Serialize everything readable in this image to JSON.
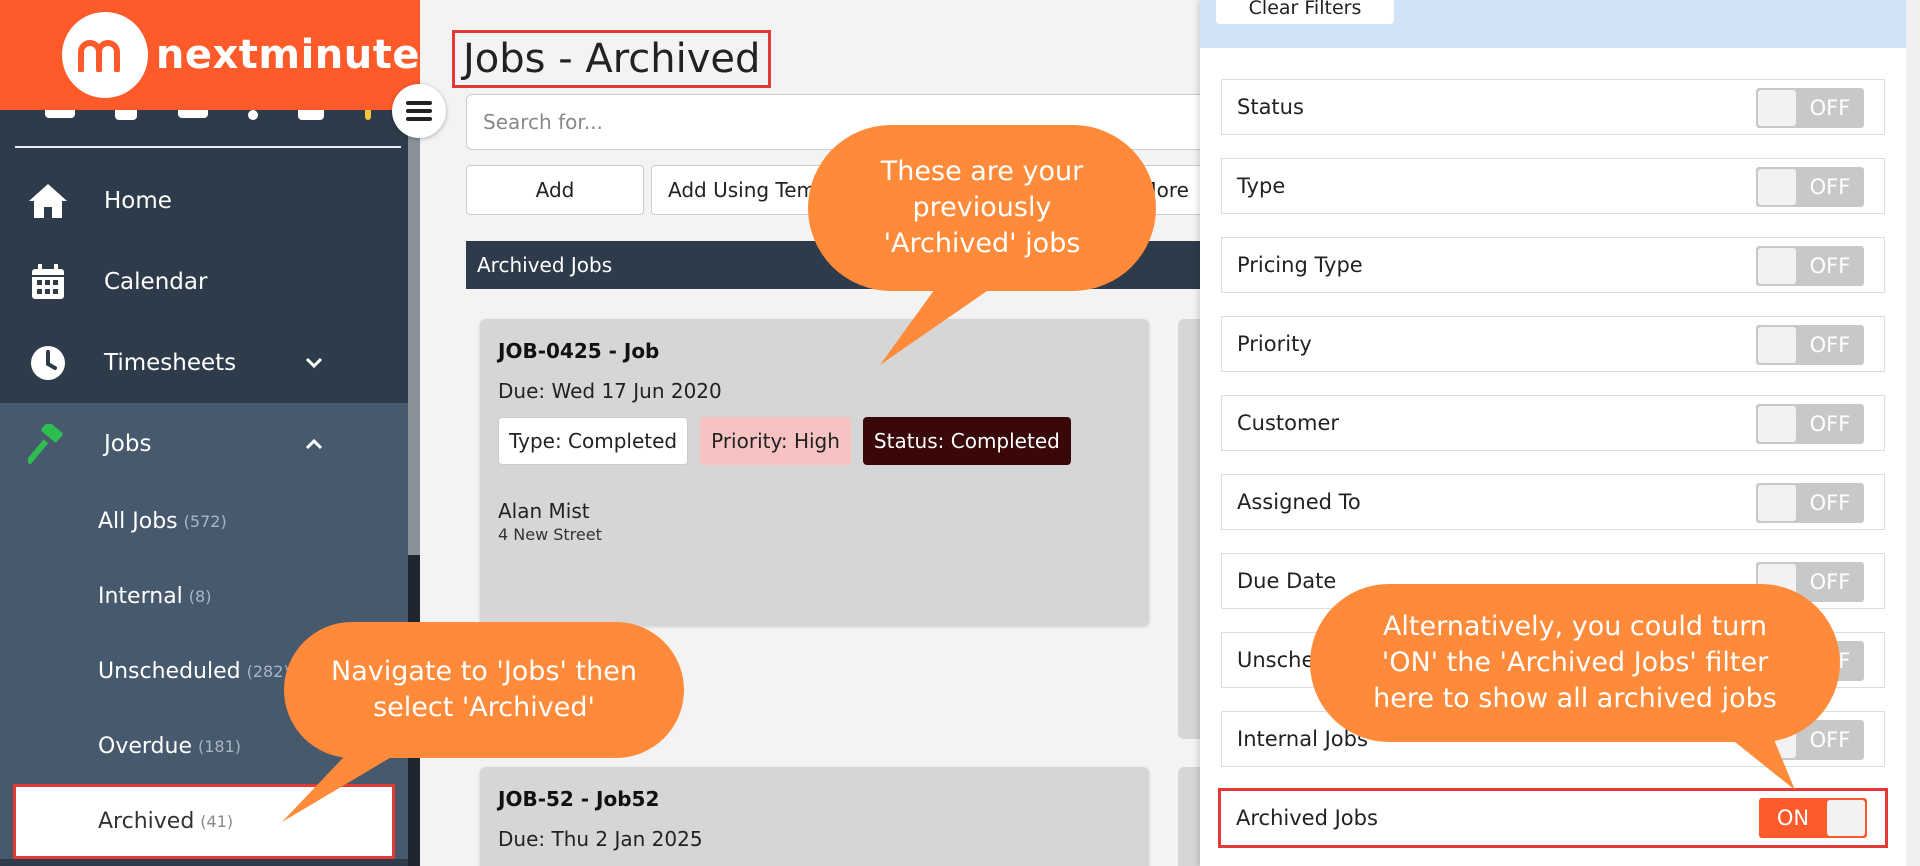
{
  "app": {
    "brand": "nextminute",
    "brand_color": "#ff5a2a",
    "accent_dark": "#2e3b4a"
  },
  "sidebar": {
    "items": [
      {
        "label": "Home",
        "icon": "home-icon"
      },
      {
        "label": "Calendar",
        "icon": "calendar-icon"
      },
      {
        "label": "Timesheets",
        "icon": "clock-icon"
      },
      {
        "label": "Jobs",
        "icon": "hammer-icon"
      }
    ],
    "jobs_sub": [
      {
        "label": "All Jobs",
        "count": "(572)"
      },
      {
        "label": "Internal",
        "count": "(8)"
      },
      {
        "label": "Unscheduled",
        "count": "(282)"
      },
      {
        "label": "Overdue",
        "count": "(181)"
      },
      {
        "label": "Archived",
        "count": "(41)"
      }
    ]
  },
  "main": {
    "title": "Jobs - Archived",
    "search_placeholder": "Search for...",
    "buttons": {
      "add": "Add",
      "add_template": "Add Using Template",
      "more": "More"
    },
    "section_title": "Archived Jobs",
    "cards": [
      {
        "title": "JOB-0425 - Job",
        "due": "Due: Wed 17 Jun 2020",
        "type": "Type: Completed",
        "priority": "Priority: High",
        "status": "Status: Completed",
        "customer": "Alan Mist",
        "address": "4 New Street"
      },
      {
        "title": "JOB-52 - Job52",
        "due": "Due: Thu 2 Jan 2025"
      }
    ]
  },
  "filters": {
    "clear_label": "Clear Filters",
    "rows": [
      {
        "label": "Status",
        "state": "OFF"
      },
      {
        "label": "Type",
        "state": "OFF"
      },
      {
        "label": "Pricing Type",
        "state": "OFF"
      },
      {
        "label": "Priority",
        "state": "OFF"
      },
      {
        "label": "Customer",
        "state": "OFF"
      },
      {
        "label": "Assigned To",
        "state": "OFF"
      },
      {
        "label": "Due Date",
        "state": "OFF"
      },
      {
        "label": "Unscheduled",
        "state": "OFF"
      },
      {
        "label": "Internal Jobs",
        "state": "OFF"
      },
      {
        "label": "Archived Jobs",
        "state": "ON"
      }
    ]
  },
  "callouts": {
    "archived_jobs": "These are your previously 'Archived' jobs",
    "navigate": "Navigate to 'Jobs' then select 'Archived'",
    "alternative": "Alternatively, you could turn 'ON' the 'Archived Jobs' filter here to show all archived jobs",
    "color": "#ff8a3a"
  }
}
